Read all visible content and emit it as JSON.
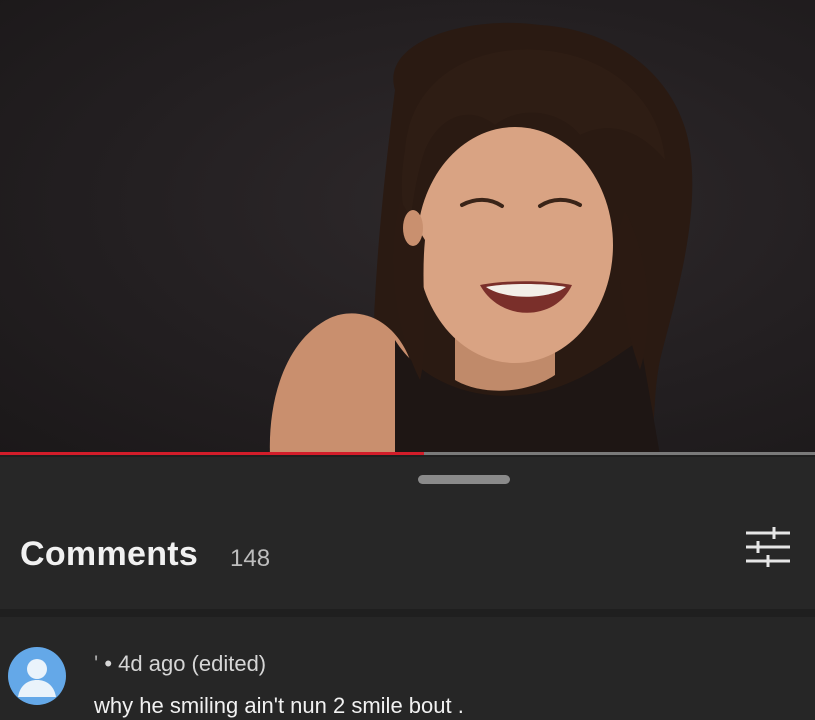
{
  "player": {
    "progress_fraction": 0.52,
    "progress_color": "#d21d2a",
    "video_frame": "woman-laughing-dark-background"
  },
  "comments_panel": {
    "title": "Comments",
    "count": "148",
    "filter_icon": "sort-sliders-icon"
  },
  "comment": {
    "author": "'",
    "meta_separator": " • ",
    "timestamp": "4d ago (edited)",
    "text": "why he smiling ain't nun 2 smile bout .",
    "avatar_color": "#64a8e8",
    "avatar_icon": "default-user-avatar-icon"
  }
}
